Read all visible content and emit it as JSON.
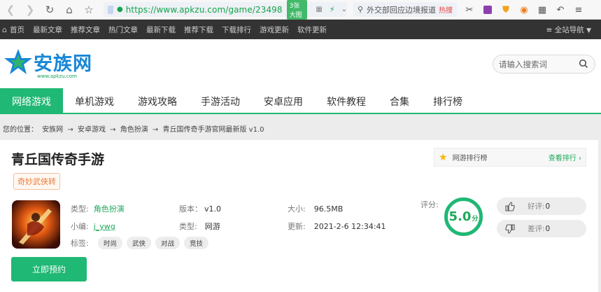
{
  "browser": {
    "url": "https://www.apkzu.com/game/23498",
    "url_tag": "3张大图",
    "search_text": "外交部回应边境报道",
    "search_hot": "热搜"
  },
  "topbar": {
    "links": [
      "首页",
      "最新文章",
      "推荐文章",
      "热门文章",
      "最新下载",
      "推荐下载",
      "下载排行",
      "游戏更新",
      "软件更新"
    ],
    "site_nav": "全站导航"
  },
  "header": {
    "logo_text": "安族网",
    "logo_sub": "www.apkzu.com",
    "search_placeholder": "请输入搜索词"
  },
  "nav": {
    "items": [
      "网络游戏",
      "单机游戏",
      "游戏攻略",
      "手游活动",
      "安卓应用",
      "软件教程",
      "合集",
      "排行榜"
    ],
    "active_index": 0
  },
  "breadcrumb": {
    "prefix": "您的位置：",
    "items": [
      "安族网",
      "安卓游戏",
      "角色扮演",
      "青丘国传奇手游官网最新版 v1.0"
    ],
    "separator": "→"
  },
  "game": {
    "title": "青丘国传奇手游",
    "tag": "奇妙武侠转",
    "type_label": "类型:",
    "type_value": "角色扮演",
    "version_label": "版本：",
    "version_value": "v1.0",
    "size_label": "大小:",
    "size_value": "96.5MB",
    "editor_label": "小编:",
    "editor_value": "j_ywg",
    "type2_label": "类型:",
    "type2_value": "网游",
    "update_label": "更新:",
    "update_value": "2021-2-6 12:34:41",
    "tags_label": "标签:",
    "tags": [
      "时尚",
      "武侠",
      "对战",
      "竞技"
    ],
    "reserve_button": "立即预约"
  },
  "rank": {
    "title": "网游排行榜",
    "more": "查看排行"
  },
  "rating": {
    "label": "评分:",
    "score": "5.0",
    "unit": "分",
    "score_fraction": 1.0,
    "like_label": "好评:",
    "like_count": "0",
    "dislike_label": "差评:",
    "dislike_count": "0"
  },
  "colors": {
    "accent": "#1fb874",
    "link": "#1ca85a",
    "topbar": "#333333",
    "logo_blue": "#1787d8"
  }
}
